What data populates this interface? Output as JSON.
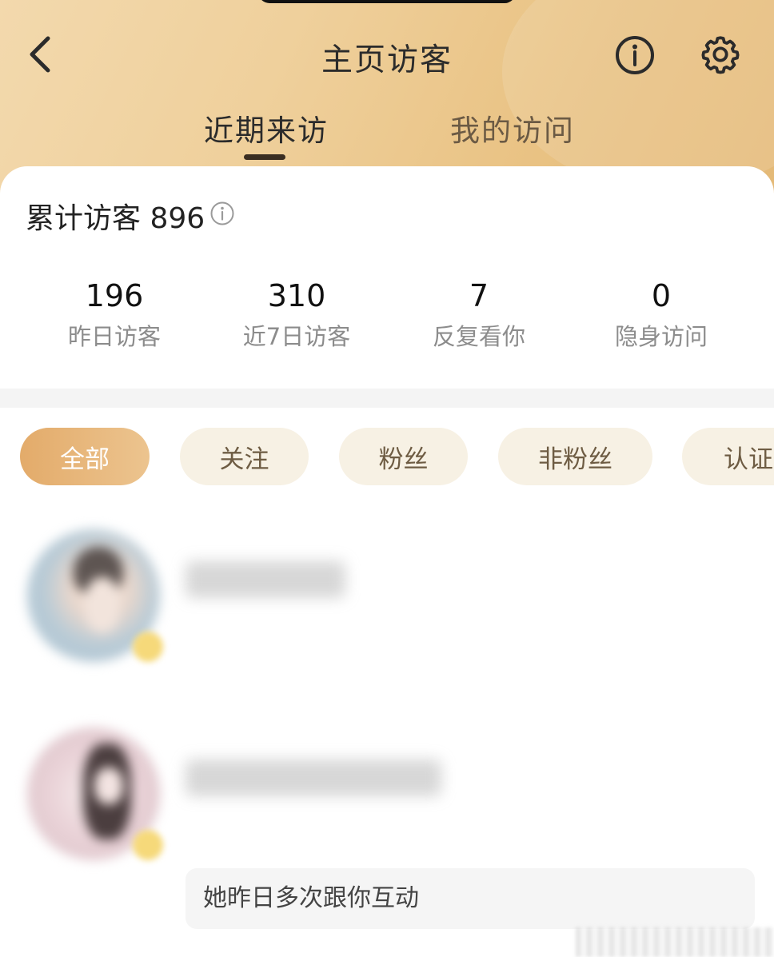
{
  "header": {
    "title": "主页访客",
    "back_icon": "back-arrow-icon",
    "info_icon": "info-icon",
    "settings_icon": "gear-icon"
  },
  "tabs": [
    {
      "label": "近期来访",
      "active": true
    },
    {
      "label": "我的访问",
      "active": false
    }
  ],
  "summary": {
    "total_label": "累计访客",
    "total_value": "896",
    "info_icon": "info-icon"
  },
  "stats": [
    {
      "value": "196",
      "label": "昨日访客"
    },
    {
      "value": "310",
      "label": "近7日访客"
    },
    {
      "value": "7",
      "label": "反复看你"
    },
    {
      "value": "0",
      "label": "隐身访问"
    }
  ],
  "filters": [
    {
      "label": "全部",
      "active": true
    },
    {
      "label": "关注",
      "active": false
    },
    {
      "label": "粉丝",
      "active": false
    },
    {
      "label": "非粉丝",
      "active": false
    },
    {
      "label": "认证",
      "active": false
    }
  ],
  "visitors": [
    {
      "name": "",
      "note": ""
    },
    {
      "name": "",
      "note": "她昨日多次跟你互动"
    }
  ],
  "colors": {
    "header_gradient_start": "#f3d9ad",
    "header_gradient_end": "#e4b977",
    "active_chip_start": "#e3ab6a",
    "active_chip_end": "#ecc48f",
    "chip_bg": "#f7f1e4",
    "chip_text": "#6e5c43"
  }
}
